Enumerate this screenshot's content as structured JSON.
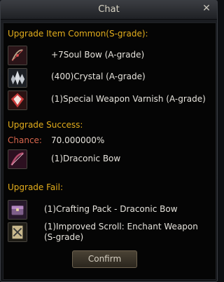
{
  "window": {
    "title": "Chat"
  },
  "upgrade_item": {
    "heading": "Upgrade Item Common(S-grade):",
    "items": [
      {
        "label": "+7Soul Bow (A-grade)",
        "icon": "soul-bow-icon"
      },
      {
        "label": "(400)Crystal (A-grade)",
        "icon": "crystal-icon"
      },
      {
        "label": "(1)Special Weapon Varnish (A-grade)",
        "icon": "weapon-varnish-icon"
      }
    ]
  },
  "upgrade_success": {
    "heading": "Upgrade Success:",
    "chance_label": "Chance:",
    "chance_value": "70.000000%",
    "result": {
      "label": "(1)Draconic Bow",
      "icon": "draconic-bow-icon"
    }
  },
  "upgrade_fail": {
    "heading": "Upgrade Fail:",
    "items": [
      {
        "label": "(1)Crafting Pack - Draconic Bow",
        "icon": "crafting-pack-icon"
      },
      {
        "label": "(1)Improved Scroll: Enchant Weapon (S-grade)",
        "icon": "enchant-scroll-icon"
      }
    ]
  },
  "buttons": {
    "confirm": "Confirm"
  },
  "colors": {
    "heading": "#e3ad1c",
    "chance_label": "#d8664d",
    "text": "#e6e3dc"
  }
}
